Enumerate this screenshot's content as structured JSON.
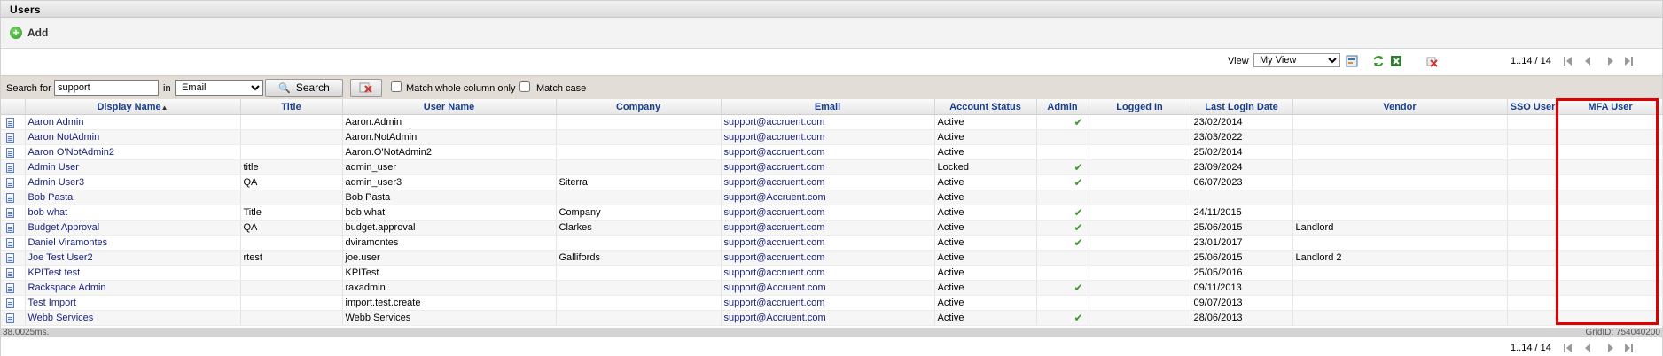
{
  "window": {
    "title": "Users"
  },
  "add": {
    "label": "Add",
    "icon": "plus-circle-icon"
  },
  "toolbar": {
    "view_label": "View",
    "view_value": "My View",
    "pager_text": "1..14 / 14"
  },
  "search": {
    "search_for_label": "Search for",
    "value": "support",
    "in_label": "in",
    "field_value": "Email",
    "search_button": "Search",
    "match_whole_label": "Match whole column only",
    "match_case_label": "Match case"
  },
  "columns": [
    "",
    "Display Name",
    "Title",
    "User Name",
    "Company",
    "Email",
    "Account Status",
    "Admin",
    "Logged In",
    "Last Login Date",
    "Vendor",
    "SSO User",
    "MFA User"
  ],
  "sort": {
    "column": "Display Name",
    "direction": "asc"
  },
  "rows": [
    {
      "display_name": "Aaron Admin",
      "title": "",
      "user_name": "Aaron.Admin",
      "company": "",
      "email": "support@accruent.com",
      "status": "Active",
      "admin": true,
      "logged_in": "",
      "last_login": "23/02/2014",
      "vendor": "",
      "sso": "",
      "mfa": ""
    },
    {
      "display_name": "Aaron NotAdmin",
      "title": "",
      "user_name": "Aaron.NotAdmin",
      "company": "",
      "email": "support@accruent.com",
      "status": "Active",
      "admin": false,
      "logged_in": "",
      "last_login": "23/03/2022",
      "vendor": "",
      "sso": "",
      "mfa": ""
    },
    {
      "display_name": "Aaron O'NotAdmin2",
      "title": "",
      "user_name": "Aaron.O'NotAdmin2",
      "company": "",
      "email": "support@accruent.com",
      "status": "Active",
      "admin": false,
      "logged_in": "",
      "last_login": "25/02/2014",
      "vendor": "",
      "sso": "",
      "mfa": ""
    },
    {
      "display_name": "Admin User",
      "title": "title",
      "user_name": "admin_user",
      "company": "",
      "email": "support@accruent.com",
      "status": "Locked",
      "admin": true,
      "logged_in": "",
      "last_login": "23/09/2024",
      "vendor": "",
      "sso": "",
      "mfa": ""
    },
    {
      "display_name": "Admin User3",
      "title": "QA",
      "user_name": "admin_user3",
      "company": "Siterra",
      "email": "support@accruent.com",
      "status": "Active",
      "admin": true,
      "logged_in": "",
      "last_login": "06/07/2023",
      "vendor": "",
      "sso": "",
      "mfa": ""
    },
    {
      "display_name": "Bob Pasta",
      "title": "",
      "user_name": "Bob Pasta",
      "company": "",
      "email": "support@Accruent.com",
      "status": "Active",
      "admin": false,
      "logged_in": "",
      "last_login": "",
      "vendor": "",
      "sso": "",
      "mfa": ""
    },
    {
      "display_name": "bob what",
      "title": "Title",
      "user_name": "bob.what",
      "company": "Company",
      "email": "support@accruent.com",
      "status": "Active",
      "admin": true,
      "logged_in": "",
      "last_login": "24/11/2015",
      "vendor": "",
      "sso": "",
      "mfa": ""
    },
    {
      "display_name": "Budget Approval",
      "title": "QA",
      "user_name": "budget.approval",
      "company": "Clarkes",
      "email": "support@accruent.com",
      "status": "Active",
      "admin": true,
      "logged_in": "",
      "last_login": "25/06/2015",
      "vendor": "Landlord",
      "sso": "",
      "mfa": ""
    },
    {
      "display_name": "Daniel Viramontes",
      "title": "",
      "user_name": "dviramontes",
      "company": "",
      "email": "support@accruent.com",
      "status": "Active",
      "admin": true,
      "logged_in": "",
      "last_login": "23/01/2017",
      "vendor": "",
      "sso": "",
      "mfa": ""
    },
    {
      "display_name": "Joe Test User2",
      "title": "rtest",
      "user_name": "joe.user",
      "company": "Gallifords",
      "email": "support@accruent.com",
      "status": "Active",
      "admin": false,
      "logged_in": "",
      "last_login": "25/06/2015",
      "vendor": "Landlord 2",
      "sso": "",
      "mfa": ""
    },
    {
      "display_name": "KPITest test",
      "title": "",
      "user_name": "KPITest",
      "company": "",
      "email": "support@accruent.com",
      "status": "Active",
      "admin": false,
      "logged_in": "",
      "last_login": "25/05/2016",
      "vendor": "",
      "sso": "",
      "mfa": ""
    },
    {
      "display_name": "Rackspace Admin",
      "title": "",
      "user_name": "raxadmin",
      "company": "",
      "email": "support@Accruent.com",
      "status": "Active",
      "admin": true,
      "logged_in": "",
      "last_login": "09/11/2013",
      "vendor": "",
      "sso": "",
      "mfa": ""
    },
    {
      "display_name": "Test Import",
      "title": "",
      "user_name": "import.test.create",
      "company": "",
      "email": "support@accruent.com",
      "status": "Active",
      "admin": false,
      "logged_in": "",
      "last_login": "09/07/2013",
      "vendor": "",
      "sso": "",
      "mfa": ""
    },
    {
      "display_name": "Webb Services",
      "title": "",
      "user_name": "Webb Services",
      "company": "",
      "email": "support@Accruent.com",
      "status": "Active",
      "admin": true,
      "logged_in": "",
      "last_login": "28/06/2013",
      "vendor": "",
      "sso": "",
      "mfa": ""
    }
  ],
  "footer": {
    "timing": "38.0025ms.",
    "grid_id": "GridID: 754040200"
  },
  "bottom_pager": {
    "text": "1..14 / 14"
  },
  "colors": {
    "accent_link": "#1a237e",
    "header_text": "#1a3e8c",
    "highlight": "#e00000",
    "check": "#3a9a2a"
  }
}
